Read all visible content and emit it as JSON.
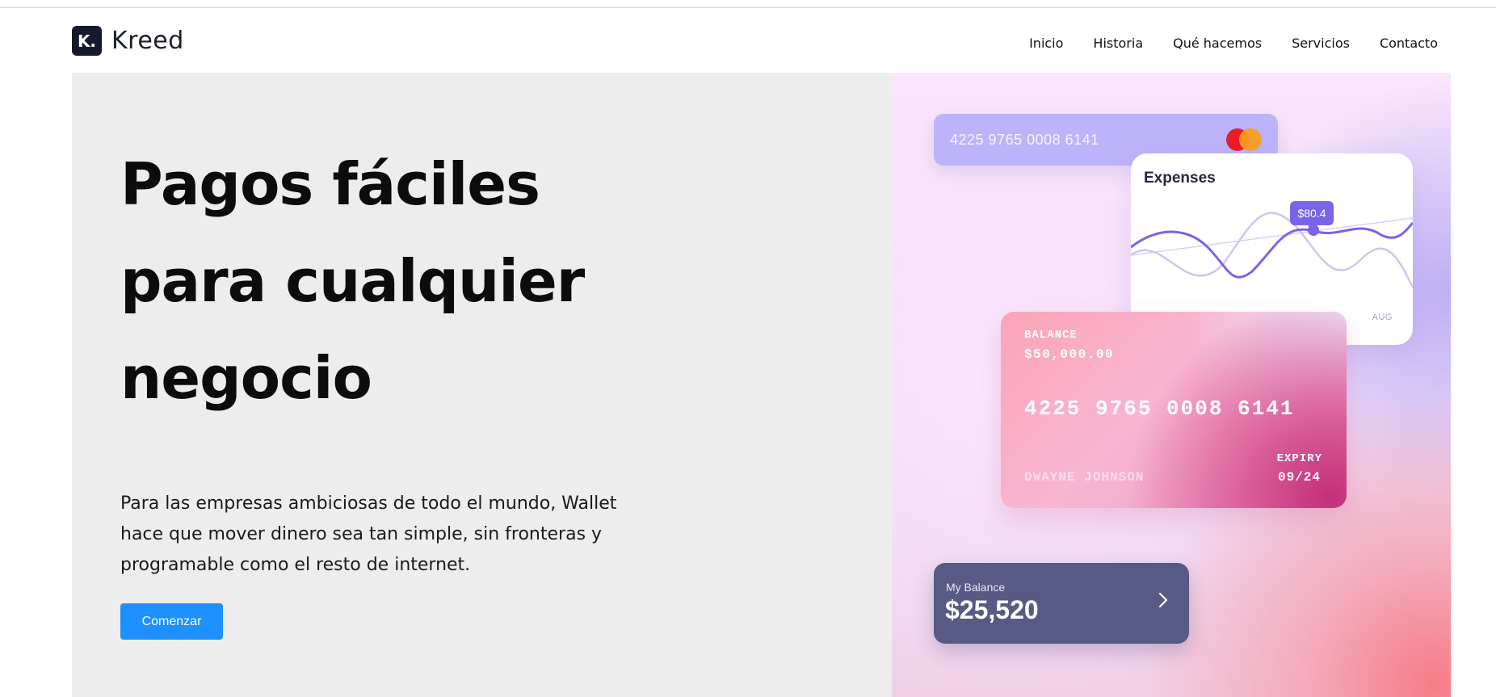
{
  "brand": {
    "mark": "K.",
    "name": "Kreed"
  },
  "nav": [
    "Inicio",
    "Historia",
    "Qué hacemos",
    "Servicios",
    "Contacto"
  ],
  "hero": {
    "headline_lines": [
      "Pagos fáciles",
      "para cualquier",
      "negocio"
    ],
    "subtext": "Para las empresas ambiciosas de todo el mundo, Wallet hace que mover dinero sea tan simple, sin fronteras y programable como el resto de internet.",
    "cta_label": "Comenzar"
  },
  "card_top": {
    "number": "4225 9765 0008 6141",
    "brand_icon": "mastercard-icon"
  },
  "expenses": {
    "title": "Expenses",
    "tooltip": "$80.4",
    "month_label": "AUG"
  },
  "balance_card": {
    "label": "BALANCE",
    "amount": "$50,000.00",
    "number": "4225 9765 0008 6141",
    "holder": "DWAYNE JOHNSON",
    "expiry_label": "EXPIRY",
    "expiry": "09/24"
  },
  "my_balance": {
    "label": "My Balance",
    "amount": "$25,520",
    "icon": "chevron-right-icon"
  },
  "colors": {
    "cta": "#1e90ff",
    "hero_left_bg": "#ededed",
    "dark_card": "#565a84",
    "accent_purple": "#7a63e6"
  }
}
